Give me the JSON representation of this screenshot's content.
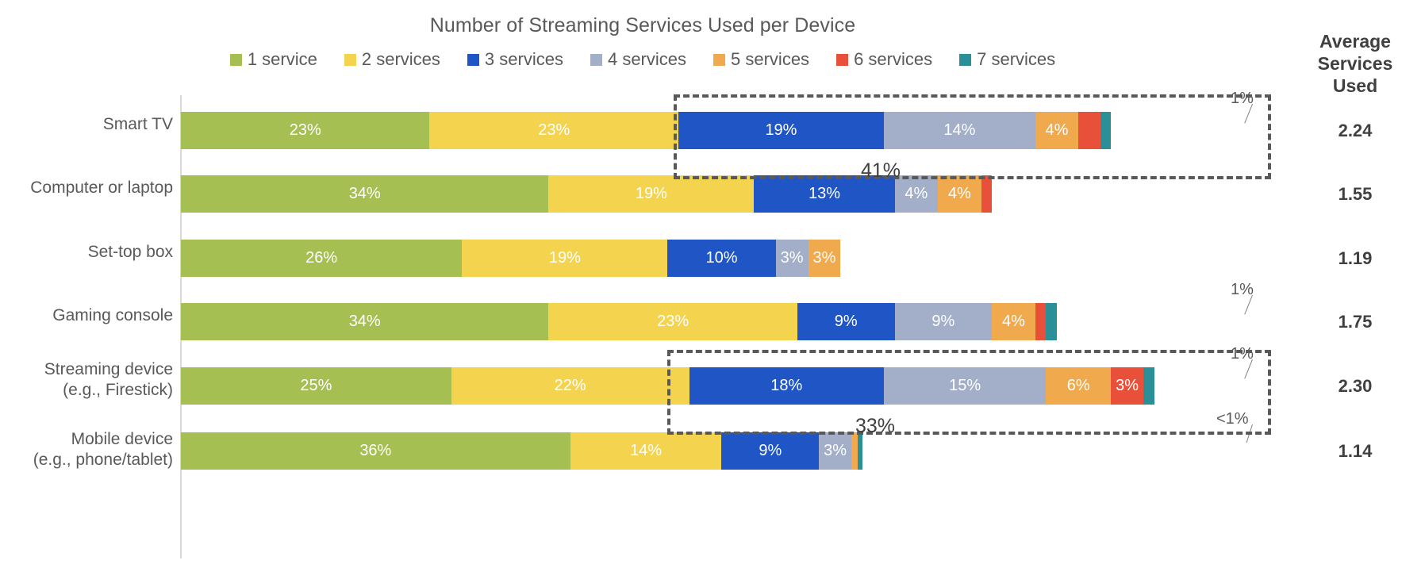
{
  "chart_data": {
    "type": "bar",
    "subtype": "100%-stacked-horizontal",
    "title": "Number of Streaming Services Used per Device",
    "xlabel": "",
    "ylabel": "",
    "grid": false,
    "legend_position": "top-center",
    "axis_max_percent": 100,
    "categories": [
      "Smart TV",
      "Computer or laptop",
      "Set-top box",
      "Gaming console",
      "Streaming device (e.g., Firestick)",
      "Mobile device (e.g., phone/tablet)"
    ],
    "series": [
      {
        "name": "1 service",
        "color": "#a5bf53",
        "values": [
          23,
          34,
          26,
          34,
          25,
          36
        ]
      },
      {
        "name": "2 services",
        "color": "#f4d44f",
        "values": [
          23,
          19,
          19,
          23,
          22,
          14
        ]
      },
      {
        "name": "3 services",
        "color": "#1f55c4",
        "values": [
          19,
          13,
          10,
          9,
          18,
          9
        ]
      },
      {
        "name": "4 services",
        "color": "#a3aec9",
        "values": [
          14,
          4,
          3,
          9,
          15,
          3
        ]
      },
      {
        "name": "5 services",
        "color": "#f0aa4d",
        "values": [
          4,
          4,
          3,
          4,
          6,
          0.6
        ]
      },
      {
        "name": "6 services",
        "color": "#e8503a",
        "values": [
          2,
          1,
          0,
          1,
          3,
          0
        ]
      },
      {
        "name": "7 services",
        "color": "#2a8f96",
        "values": [
          1,
          0,
          0,
          1,
          1,
          0.4
        ]
      }
    ],
    "value_labels": [
      [
        "23%",
        "23%",
        "19%",
        "14%",
        "4%",
        "2%",
        "1%"
      ],
      [
        "34%",
        "19%",
        "13%",
        "4%",
        "4%",
        "1%",
        ""
      ],
      [
        "26%",
        "19%",
        "10%",
        "3%",
        "3%",
        "",
        ""
      ],
      [
        "34%",
        "23%",
        "9%",
        "9%",
        "4%",
        "1%",
        "1%"
      ],
      [
        "25%",
        "22%",
        "18%",
        "15%",
        "6%",
        "3%",
        "1%"
      ],
      [
        "36%",
        "14%",
        "9%",
        "3%",
        "<1%",
        "",
        "<1%"
      ]
    ],
    "annotations": [
      {
        "row": "Smart TV",
        "label": "41%",
        "covers": "3+ services"
      },
      {
        "row": "Streaming device (e.g., Firestick)",
        "label": "33%",
        "covers": "3+ services"
      }
    ]
  },
  "legend": {
    "items": [
      {
        "label": "1 service",
        "color": "#a5bf53"
      },
      {
        "label": "2 services",
        "color": "#f4d44f"
      },
      {
        "label": "3 services",
        "color": "#1f55c4"
      },
      {
        "label": "4 services",
        "color": "#a3aec9"
      },
      {
        "label": "5 services",
        "color": "#f0aa4d"
      },
      {
        "label": "6 services",
        "color": "#e8503a"
      },
      {
        "label": "7 services",
        "color": "#2a8f96"
      }
    ]
  },
  "average_column": {
    "header_line1": "Average",
    "header_line2": "Services",
    "header_line3": "Used",
    "values": [
      "2.24",
      "1.55",
      "1.19",
      "1.75",
      "2.30",
      "1.14"
    ]
  },
  "rows": [
    {
      "label_line1": "Smart TV",
      "label_line2": "",
      "callouts": [
        {
          "text": "1%"
        }
      ],
      "highlight": "41%"
    },
    {
      "label_line1": "Computer or laptop",
      "label_line2": "",
      "callouts": [],
      "highlight": ""
    },
    {
      "label_line1": "Set-top box",
      "label_line2": "",
      "callouts": [],
      "highlight": ""
    },
    {
      "label_line1": "Gaming console",
      "label_line2": "",
      "callouts": [
        {
          "text": "1%"
        }
      ],
      "highlight": ""
    },
    {
      "label_line1": "Streaming device",
      "label_line2": "(e.g., Firestick)",
      "callouts": [
        {
          "text": "1%"
        }
      ],
      "highlight": "33%"
    },
    {
      "label_line1": "Mobile device",
      "label_line2": "(e.g., phone/tablet)",
      "callouts": [
        {
          "text": "<1%"
        }
      ],
      "highlight": ""
    }
  ]
}
